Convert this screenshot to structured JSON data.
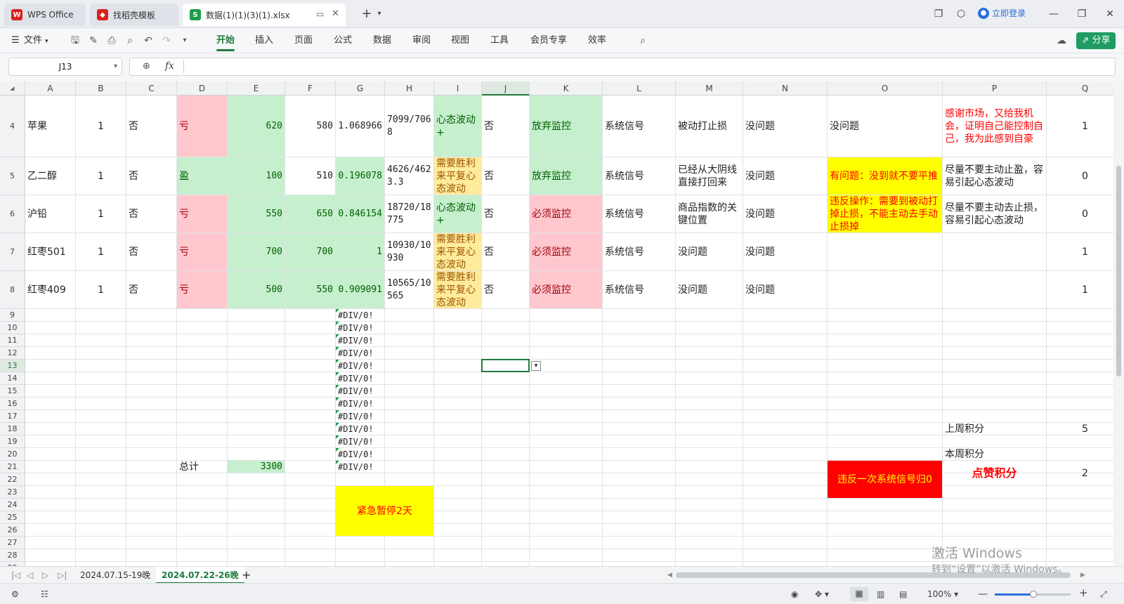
{
  "app": {
    "tabs": [
      {
        "label": "WPS Office",
        "icon": "wps-logo-icon",
        "color": "#d9211c"
      },
      {
        "label": "找稻壳模板",
        "icon": "docer-icon",
        "color": "#d9211c"
      },
      {
        "label": "数据(1)(1)(3)(1).xlsx",
        "icon": "spreadsheet-icon",
        "color": "#1e9c49"
      }
    ],
    "login_label": "立即登录",
    "share_label": "分享"
  },
  "ribbon": {
    "file_label": "文件",
    "menus": [
      "开始",
      "插入",
      "页面",
      "公式",
      "数据",
      "审阅",
      "视图",
      "工具",
      "会员专享",
      "效率"
    ],
    "active_menu": "开始"
  },
  "formula_bar": {
    "cell_ref": "J13",
    "fx_label": "fx",
    "content": ""
  },
  "grid": {
    "columns": [
      "A",
      "B",
      "C",
      "D",
      "E",
      "F",
      "G",
      "H",
      "I",
      "J",
      "K",
      "L",
      "M",
      "N",
      "O",
      "P",
      "Q"
    ],
    "selected_column": "J",
    "selected_row": "13",
    "rows": [
      "4",
      "5",
      "6",
      "7",
      "8",
      "9",
      "10",
      "11",
      "12",
      "13",
      "14",
      "15",
      "16",
      "17",
      "18",
      "19",
      "20",
      "21",
      "22",
      "23",
      "24",
      "25",
      "26",
      "27",
      "28",
      "29"
    ],
    "data_rows": [
      {
        "A": "苹果",
        "B": "1",
        "C": "否",
        "D": "亏",
        "E": "620",
        "F": "580",
        "G": "1.068966",
        "H": "7099/7068",
        "I": "心态波动+",
        "J": "否",
        "K": "放弃监控",
        "L": "系统信号",
        "M": "被动打止损",
        "N": "没问题",
        "O": "没问题",
        "P": "感谢市场，又给我机会，证明自己能控制自己，我为此感到自豪",
        "Q": "1"
      },
      {
        "A": "乙二醇",
        "B": "1",
        "C": "否",
        "D": "盈",
        "E": "100",
        "F": "510",
        "G": "0.196078",
        "H": "4626/4623.3",
        "I": "需要胜利来平复心态波动",
        "J": "否",
        "K": "放弃监控",
        "L": "系统信号",
        "M": "已经从大阴线直接打回来",
        "N": "没问题",
        "O": "有问题：没到就不要平推",
        "P": "尽量不要主动止盈，容易引起心态波动",
        "Q": "0"
      },
      {
        "A": "沪铅",
        "B": "1",
        "C": "否",
        "D": "亏",
        "E": "550",
        "F": "650",
        "G": "0.846154",
        "H": "18720/18775",
        "I": "心态波动+",
        "J": "否",
        "K": "必须监控",
        "L": "系统信号",
        "M": "商品指数的关键位置",
        "N": "没问题",
        "O": "违反操作：需要到被动打掉止损，不能主动去手动止损掉",
        "P": "尽量不要主动去止损，容易引起心态波动",
        "Q": "0"
      },
      {
        "A": "红枣501",
        "B": "1",
        "C": "否",
        "D": "亏",
        "E": "700",
        "F": "700",
        "G": "1",
        "H": "10930/10930",
        "I": "需要胜利来平复心态波动",
        "J": "否",
        "K": "必须监控",
        "L": "系统信号",
        "M": "没问题",
        "N": "没问题",
        "O": "",
        "P": "",
        "Q": "1"
      },
      {
        "A": "红枣409",
        "B": "1",
        "C": "否",
        "D": "亏",
        "E": "500",
        "F": "550",
        "G": "0.909091",
        "H": "10565/10565",
        "I": "需要胜利来平复心态波动",
        "J": "否",
        "K": "必须监控",
        "L": "系统信号",
        "M": "没问题",
        "N": "没问题",
        "O": "",
        "P": "",
        "Q": "1"
      }
    ],
    "div_error": "#DIV/0!",
    "total_label": "总计",
    "total_value": "3300",
    "pause_note": "紧急暂停2天",
    "last_week_label": "上周积分",
    "last_week_value": "5",
    "this_week_label": "本周积分",
    "this_week_value": "-",
    "violation_note": "违反一次系统信号归0",
    "like_label": "点赞积分",
    "like_value": "2"
  },
  "sheets": [
    "2024.07.15-19晚",
    "2024.07.22-26晚"
  ],
  "active_sheet": "2024.07.22-26晚",
  "status": {
    "zoom": "100%"
  },
  "watermark": {
    "line1": "激活 Windows",
    "line2": "转到“设置”以激活 Windows。"
  },
  "colors": {
    "green_fill": "#c6efce",
    "red_fill": "#ffc7ce",
    "yellow_fill": "#ffeb9c",
    "bright_yellow": "#ffff00",
    "bright_red": "#ff0000",
    "accent": "#1e7b3c"
  }
}
